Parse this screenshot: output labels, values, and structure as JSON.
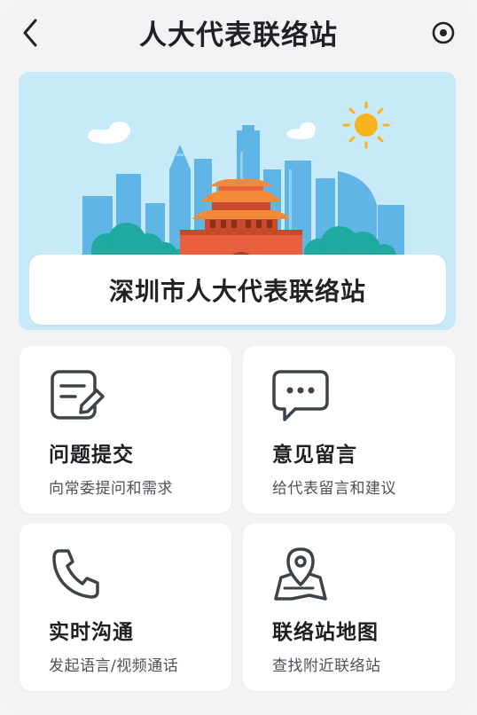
{
  "header": {
    "title": "人大代表联络站",
    "back_icon": "chevron-left-icon",
    "action_icon": "target-icon"
  },
  "banner": {
    "title": "深圳市人大代表联络站"
  },
  "cards": [
    {
      "title": "问题提交",
      "subtitle": "向常委提问和需求",
      "icon": "edit-note-icon"
    },
    {
      "title": "意见留言",
      "subtitle": "给代表留言和建议",
      "icon": "chat-bubble-icon"
    },
    {
      "title": "实时沟通",
      "subtitle": "发起语言/视频通话",
      "icon": "phone-icon"
    },
    {
      "title": "联络站地图",
      "subtitle": "查找附近联络站",
      "icon": "map-pin-icon"
    }
  ],
  "colors": {
    "sky": "#c7eaf8",
    "buildings": "#5fb6e6",
    "gate_red": "#e8603c",
    "gate_roof": "#f28a3a",
    "trees": "#1fa9a0",
    "sun": "#f7b31e"
  }
}
